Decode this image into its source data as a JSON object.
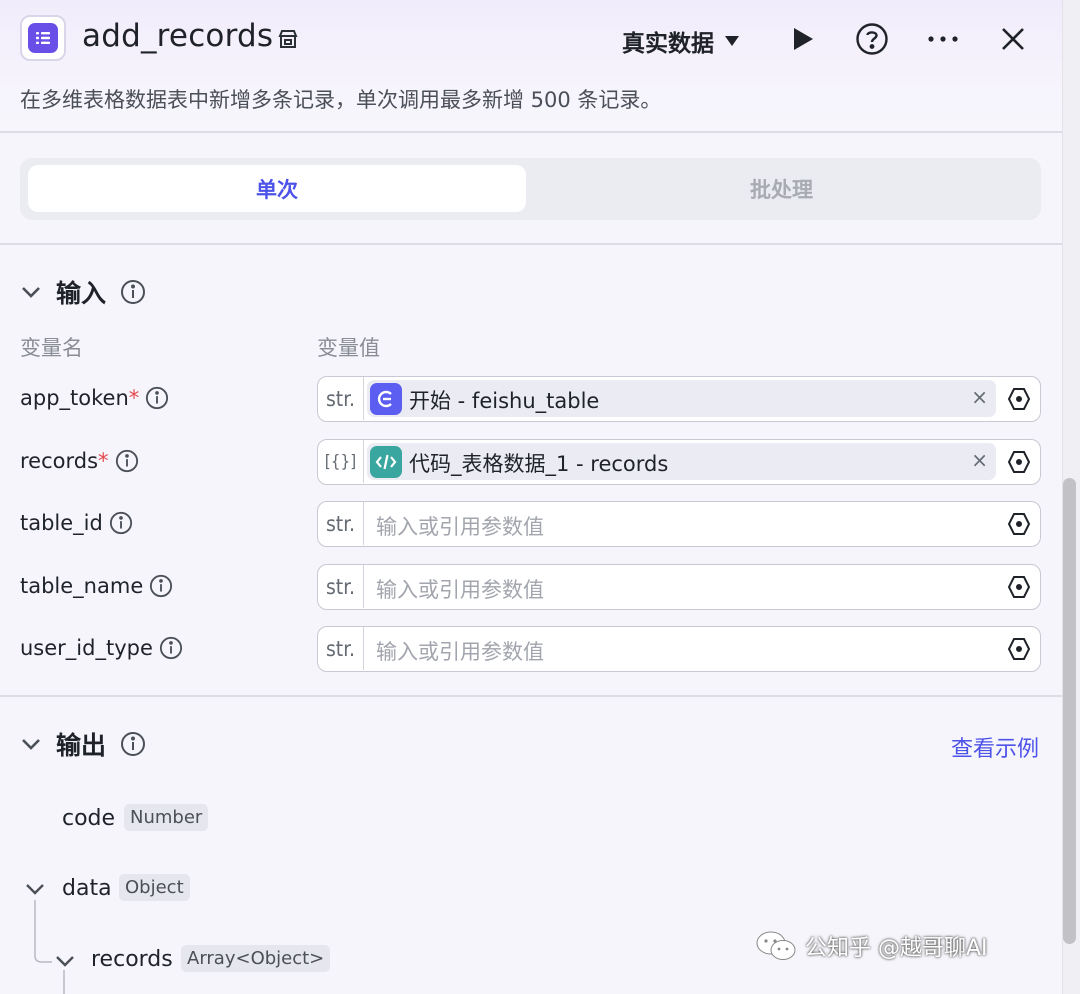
{
  "header": {
    "title": "add_records",
    "mode_label": "真实数据",
    "description": "在多维表格数据表中新增多条记录，单次调用最多新增 500 条记录。"
  },
  "tabs": [
    {
      "label": "单次",
      "active": true
    },
    {
      "label": "批处理",
      "active": false
    }
  ],
  "input_section": {
    "title": "输入",
    "col_name": "变量名",
    "col_value": "变量值",
    "rows": [
      {
        "name": "app_token",
        "required": true,
        "type": "str.",
        "ref_source": "开始",
        "ref_text": "开始 - feishu_table",
        "placeholder": ""
      },
      {
        "name": "records",
        "required": true,
        "type": "[{}]",
        "ref_source": "代码_表格数据_1",
        "ref_text": "代码_表格数据_1 - records",
        "placeholder": ""
      },
      {
        "name": "table_id",
        "required": false,
        "type": "str.",
        "placeholder": "输入或引用参数值"
      },
      {
        "name": "table_name",
        "required": false,
        "type": "str.",
        "placeholder": "输入或引用参数值"
      },
      {
        "name": "user_id_type",
        "required": false,
        "type": "str.",
        "placeholder": "输入或引用参数值"
      }
    ],
    "required_mark": "*",
    "clear_mark": "×"
  },
  "output_section": {
    "title": "输出",
    "view_example": "查看示例",
    "items": [
      {
        "name": "code",
        "type": "Number"
      },
      {
        "name": "data",
        "type": "Object"
      },
      {
        "name": "records",
        "type": "Array<Object>"
      }
    ]
  },
  "watermark": "公知乎 @越哥聊AI",
  "colors": {
    "accent": "#4d53e8",
    "app_icon": "#6a4ee8",
    "start_node": "#5b5ef0",
    "code_node": "#3aa6a0",
    "required": "#e5484d"
  },
  "icons": [
    "table-icon",
    "node-badge-icon",
    "caret-down-icon",
    "play-icon",
    "help-icon",
    "more-icon",
    "close-icon",
    "chevron-down-icon",
    "info-icon",
    "variable-icon",
    "wechat-icon"
  ]
}
